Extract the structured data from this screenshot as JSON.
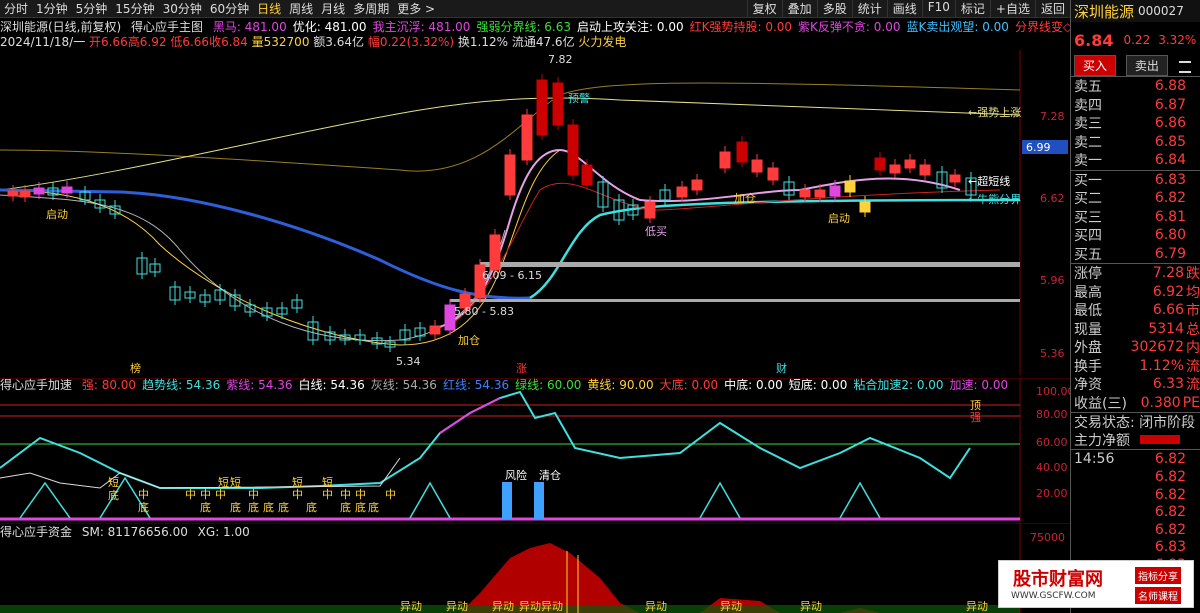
{
  "toolbar": {
    "items": [
      "分时",
      "1分钟",
      "5分钟",
      "15分钟",
      "30分钟",
      "60分钟",
      "日线",
      "周线",
      "月线",
      "多周期",
      "更多 >"
    ],
    "active": "日线",
    "right": [
      "复权",
      "叠加",
      "多股",
      "统计",
      "画线",
      "F10",
      "标记",
      "+自选",
      "返回"
    ]
  },
  "header": {
    "title": "深圳能源(日线,前复权)",
    "formula": "得心应手主图",
    "items": [
      {
        "t": "黑马: 481.00",
        "c": "#e046e0"
      },
      {
        "t": "优化: 481.00",
        "c": "#ffffff"
      },
      {
        "t": "我主沉浮: 481.00",
        "c": "#e046e0"
      },
      {
        "t": "强弱分界线: 6.63",
        "c": "#3cdf3c"
      },
      {
        "t": "启动上攻关注: 0.00",
        "c": "#ffffff"
      },
      {
        "t": "红K强势持股: 0.00",
        "c": "#ff3b3b"
      },
      {
        "t": "紫K反弹不贪: 0.00",
        "c": "#e046e0"
      },
      {
        "t": "蓝K卖出观望: 0.00",
        "c": "#3fc0ff"
      },
      {
        "t": "分界线变◇",
        "c": "#ff3b3b"
      }
    ]
  },
  "quote_line": {
    "date": "2024/11/18/一",
    "open": "开6.66",
    "high": "高6.92",
    "low": "低6.66",
    "close": "收6.84",
    "vol": "量532700",
    "amt": "额3.64亿",
    "chg": "幅0.22(3.32%)",
    "turn": "换1.12%",
    "float": "流通47.6亿",
    "note": "火力发电"
  },
  "main_axis": [
    "7.28",
    "6.62",
    "5.96",
    "5.36"
  ],
  "main_labels": {
    "top": "7.82",
    "bottom": "5.34",
    "zone1": "6.09 - 6.15",
    "zone2": "5.80 - 5.83",
    "qidong1": "启动",
    "qidong2": "启动",
    "jiacang1": "加仓",
    "jiacang2": "加仓",
    "dimai": "低买",
    "yujing": "预警",
    "ruoqiang": "←强势上涨",
    "chaoduan": "←超短线",
    "niuxiong": "←牛熊分界",
    "current_price": "6.99",
    "bottom_marks": [
      "榜",
      "涨",
      "财"
    ]
  },
  "panel2": {
    "title": "得心应手加速",
    "items": [
      {
        "t": "强: 80.00",
        "c": "#ff3b3b"
      },
      {
        "t": "趋势线: 54.36",
        "c": "#3fe0e0"
      },
      {
        "t": "紫线: 54.36",
        "c": "#e046e0"
      },
      {
        "t": "白线: 54.36",
        "c": "#ffffff"
      },
      {
        "t": "灰线: 54.36",
        "c": "#aaaaaa"
      },
      {
        "t": "红线: 54.36",
        "c": "#3f7fff"
      },
      {
        "t": "绿线: 60.00",
        "c": "#3cdf3c"
      },
      {
        "t": "黄线: 90.00",
        "c": "#ffd23a"
      },
      {
        "t": "大底: 0.00",
        "c": "#ff3b3b"
      },
      {
        "t": "中底: 0.00",
        "c": "#ffffff"
      },
      {
        "t": "短底: 0.00",
        "c": "#ffffff"
      },
      {
        "t": "粘合加速2: 0.00",
        "c": "#3fe0e0"
      },
      {
        "t": "加速: 0.00",
        "c": "#e046e0"
      }
    ],
    "axis": [
      "100.00",
      "80.00",
      "60.00",
      "40.00",
      "20.00"
    ],
    "labels": {
      "ding": "顶",
      "qiang": "强",
      "fengxian": "风险",
      "qingcang": "清仓",
      "duan": "短",
      "di": "底",
      "zhong": "中"
    }
  },
  "panel3": {
    "title": "得心应手资金",
    "sm": "SM: 81176656.00",
    "xg": "XG: 1.00",
    "axis": [
      "75000"
    ],
    "yidong": "异动",
    "yidong_labels": [
      "异动",
      "异动",
      "异动",
      "异动异动",
      "异动",
      "异动",
      "异动",
      "异动",
      "异动"
    ]
  },
  "side": {
    "name": "深圳能源",
    "code": "000027",
    "price": "6.84",
    "change": "0.22",
    "pct": "3.32%",
    "buy": "买入",
    "sell": "卖出",
    "asks": [
      {
        "l": "卖五",
        "v": "6.88"
      },
      {
        "l": "卖四",
        "v": "6.87"
      },
      {
        "l": "卖三",
        "v": "6.86"
      },
      {
        "l": "卖二",
        "v": "6.85"
      },
      {
        "l": "卖一",
        "v": "6.84"
      }
    ],
    "bids": [
      {
        "l": "买一",
        "v": "6.83"
      },
      {
        "l": "买二",
        "v": "6.82"
      },
      {
        "l": "买三",
        "v": "6.81"
      },
      {
        "l": "买四",
        "v": "6.80"
      },
      {
        "l": "买五",
        "v": "6.79"
      }
    ],
    "stats": [
      {
        "l": "涨停",
        "v": "7.28",
        "x": "跌"
      },
      {
        "l": "最高",
        "v": "6.92",
        "x": "均"
      },
      {
        "l": "最低",
        "v": "6.66",
        "x": "市"
      },
      {
        "l": "现量",
        "v": "5314",
        "x": "总"
      },
      {
        "l": "外盘",
        "v": "302672",
        "x": "内"
      },
      {
        "l": "换手",
        "v": "1.12%",
        "x": "流"
      },
      {
        "l": "净资",
        "v": "6.33",
        "x": "流"
      },
      {
        "l": "收益(三)",
        "v": "0.380",
        "x": "PE"
      }
    ],
    "status": "交易状态: 闭市阶段",
    "net": "主力净额",
    "time": "14:56",
    "ticks": [
      "6.82",
      "6.82",
      "6.82",
      "6.82",
      "6.82",
      "6.83",
      "6.83"
    ]
  },
  "watermark": {
    "main": "股市财富网",
    "url": "WWW.GSCFW.COM",
    "tag1": "指标分享",
    "tag2": "名师课程"
  }
}
